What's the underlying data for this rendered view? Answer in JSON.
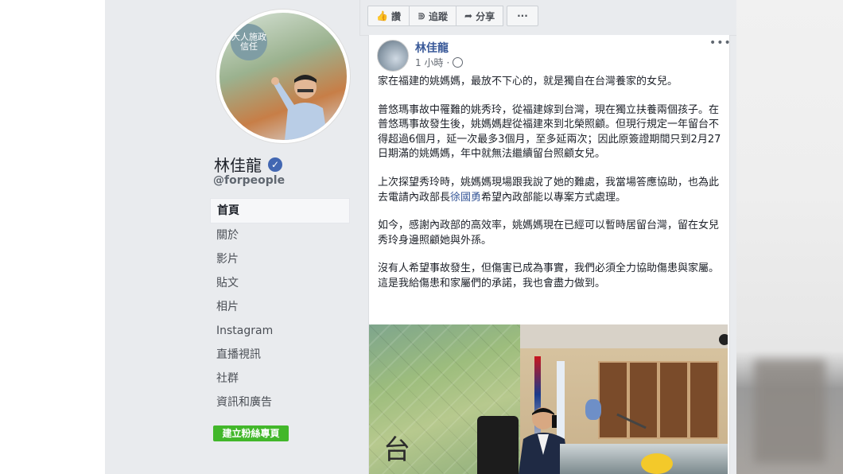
{
  "page": {
    "name": "林佳龍",
    "handle": "@forpeople",
    "avatar_text": "大人施政 信任"
  },
  "nav": {
    "items": [
      "首頁",
      "關於",
      "影片",
      "貼文",
      "相片",
      "Instagram",
      "直播視訊",
      "社群",
      "資訊和廣告"
    ],
    "create_button": "建立粉絲專頁"
  },
  "actions": {
    "like": "讚",
    "follow": "追蹤",
    "share": "分享",
    "more": "···"
  },
  "post": {
    "author": "林佳龍",
    "time": "1 小時",
    "more": "•••",
    "paragraphs": [
      "家在福建的姚媽媽，最放不下心的，就是獨自在台灣養家的女兒。",
      "普悠瑪事故中罹難的姚秀玲，從福建嫁到台灣，現在獨立扶養兩個孩子。在普悠瑪事故發生後，姚媽媽趕從福建來到北榮照顧。但現行規定一年留台不得超過6個月，延一次最多3個月，至多延兩次；因此原簽證期間只到2月27日期滿的姚媽媽，年中就無法繼續留台照顧女兒。",
      "如今，感謝內政部的高效率，姚媽媽現在已經可以暫時居留台灣，留在女兒秀玲身邊照顧她與外孫。",
      "沒有人希望事故發生，但傷害已成為事實，我們必須全力協助傷患與家屬。這是我給傷患和家屬們的承諾，我也會盡力做到。"
    ],
    "p3_before": "上次探望秀玲時，姚媽媽現場跟我說了她的難處，我當場答應協助，也為此去電請內政部長",
    "p3_link": "徐國勇",
    "p3_after": "希望內政部能以專案方式處理。"
  },
  "colors": {
    "accent": "#385898",
    "create_button": "#42b72a",
    "verified": "#4267b2"
  }
}
